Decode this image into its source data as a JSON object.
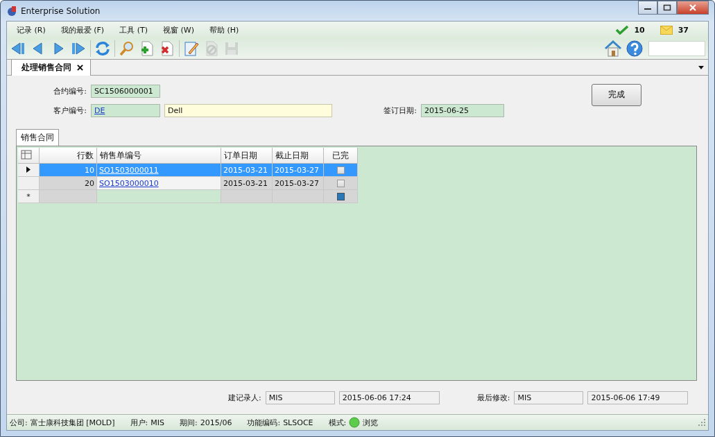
{
  "window": {
    "title": "Enterprise Solution"
  },
  "menu": [
    "记录 (R)",
    "我的最爱 (F)",
    "工具 (T)",
    "视窗 (W)",
    "帮助 (H)"
  ],
  "notifications": [
    {
      "kind": "check",
      "count": "10"
    },
    {
      "kind": "mail",
      "count": "37"
    }
  ],
  "toolbar": [
    {
      "kind": "first",
      "disabled": false
    },
    {
      "kind": "prev",
      "disabled": false
    },
    {
      "kind": "next",
      "disabled": false
    },
    {
      "kind": "last",
      "disabled": false
    },
    {
      "kind": "refresh",
      "disabled": false
    },
    {
      "kind": "search",
      "disabled": false
    },
    {
      "kind": "add",
      "disabled": false
    },
    {
      "kind": "delete",
      "disabled": false
    },
    {
      "kind": "edit",
      "disabled": false
    },
    {
      "kind": "cancel",
      "disabled": true
    },
    {
      "kind": "save",
      "disabled": true
    }
  ],
  "document_tabs": [
    {
      "label": "处理销售合同",
      "selected": true
    }
  ],
  "form": {
    "contract_no": {
      "label": "合约编号:",
      "value": "SC1506000001"
    },
    "customer": {
      "label": "客户编号:",
      "code": "DE",
      "name": "Dell"
    },
    "sign_date": {
      "label": "签订日期:",
      "value": "2015-06-25"
    },
    "done_button": "完成"
  },
  "detail_tabs": [
    {
      "label": "销售合同",
      "selected": true
    }
  ],
  "table": {
    "columns": [
      "行数",
      "销售单编号",
      "订单日期",
      "截止日期",
      "已完"
    ],
    "rows": [
      {
        "kind": "data",
        "line": "10",
        "order_no": "SO1503000011",
        "order_date": "2015-03-21",
        "due_date": "2015-03-27",
        "done": false,
        "selected": true
      },
      {
        "kind": "data",
        "line": "20",
        "order_no": "SO1503000010",
        "order_date": "2015-03-21",
        "due_date": "2015-03-27",
        "done": false,
        "selected": false
      },
      {
        "kind": "new",
        "marker": "*",
        "done": true,
        "selected": false
      }
    ]
  },
  "audit": [
    {
      "label": "建记录人:",
      "user": "MIS",
      "time": "2015-06-06 17:24"
    },
    {
      "label": "最后修改:",
      "user": "MIS",
      "time": "2015-06-06 17:49"
    }
  ],
  "status_bar": [
    {
      "kind": "text",
      "label": "公司:",
      "value": "富士康科技集团 [MOLD]"
    },
    {
      "kind": "text",
      "label": "用户:",
      "value": "MIS"
    },
    {
      "kind": "text",
      "label": "期间:",
      "value": "2015/06"
    },
    {
      "kind": "text",
      "label": "功能编码:",
      "value": "SLSOCE"
    },
    {
      "kind": "mode",
      "label": "模式:",
      "value": "浏览"
    }
  ]
}
